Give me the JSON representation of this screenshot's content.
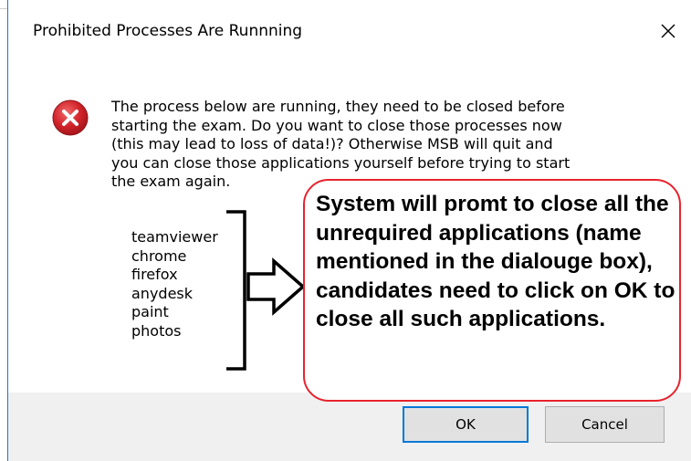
{
  "dialog": {
    "title": "Prohibited Processes Are Runnning",
    "message": "The process below are running, they need to be closed before\nstarting the exam. Do you want to close those processes now\n(this may lead to loss of data!)? Otherwise MSB will quit and\nyou can close those applications yourself before trying to start\nthe exam again.",
    "processes": [
      "teamviewer",
      "chrome",
      "firefox",
      "anydesk",
      "paint",
      "photos"
    ],
    "ok_label": "OK",
    "cancel_label": "Cancel",
    "icon": "error-icon",
    "close_icon": "close-icon"
  },
  "annotation": {
    "text": "System will promt to close all the unrequired applications (name mentioned in the dialouge box), candidates need to click on OK to close all such applications.",
    "border_color": "#e8232d",
    "arrow_icon": "right-arrow-icon"
  },
  "colors": {
    "accent": "#0078d7",
    "footer_bg": "#f0f0f0",
    "error_red": "#c4262e"
  }
}
